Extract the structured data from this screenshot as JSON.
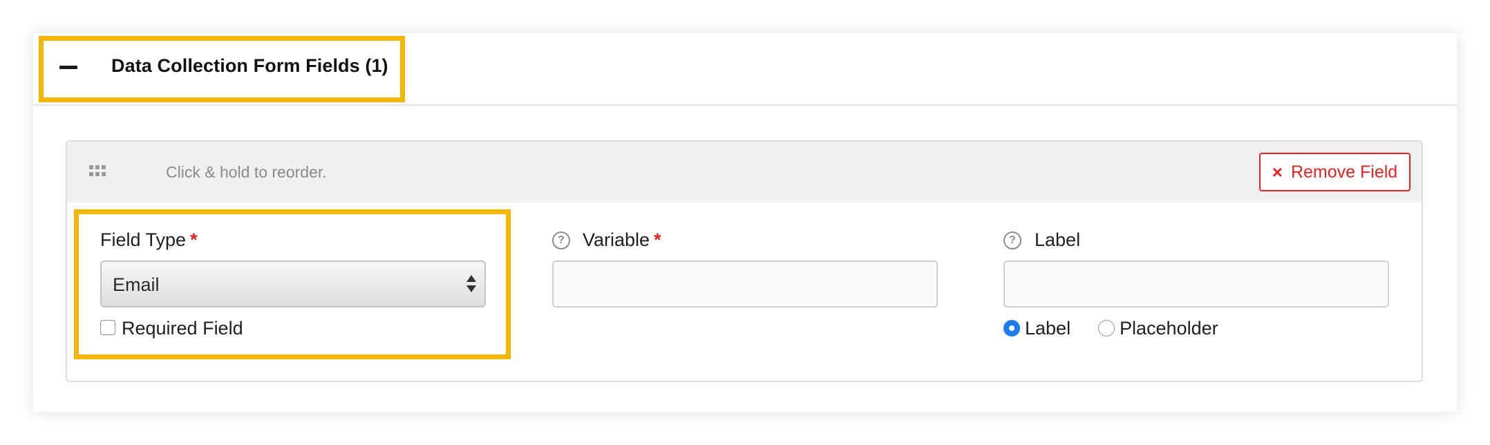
{
  "header": {
    "title": "Data Collection Form Fields (1)",
    "collapse_icon": "minus-icon"
  },
  "field_card": {
    "drag_icon": "grip-dots-icon",
    "reorder_hint": "Click & hold to reorder.",
    "remove_button": {
      "icon": "×",
      "label": "Remove Field"
    },
    "field_type": {
      "label": "Field Type",
      "required_marker": "*",
      "selected_value": "Email"
    },
    "required_checkbox": {
      "label": "Required Field",
      "checked": false
    },
    "variable": {
      "help_icon": "?",
      "label": "Variable",
      "required_marker": "*",
      "value": ""
    },
    "label_field": {
      "help_icon": "?",
      "label": "Label",
      "value": ""
    },
    "label_mode": {
      "options": [
        {
          "label": "Label",
          "selected": true
        },
        {
          "label": "Placeholder",
          "selected": false
        }
      ]
    }
  },
  "colors": {
    "highlight": "#f5b600",
    "danger": "#e02424",
    "radio_accent": "#1a7cf0"
  }
}
